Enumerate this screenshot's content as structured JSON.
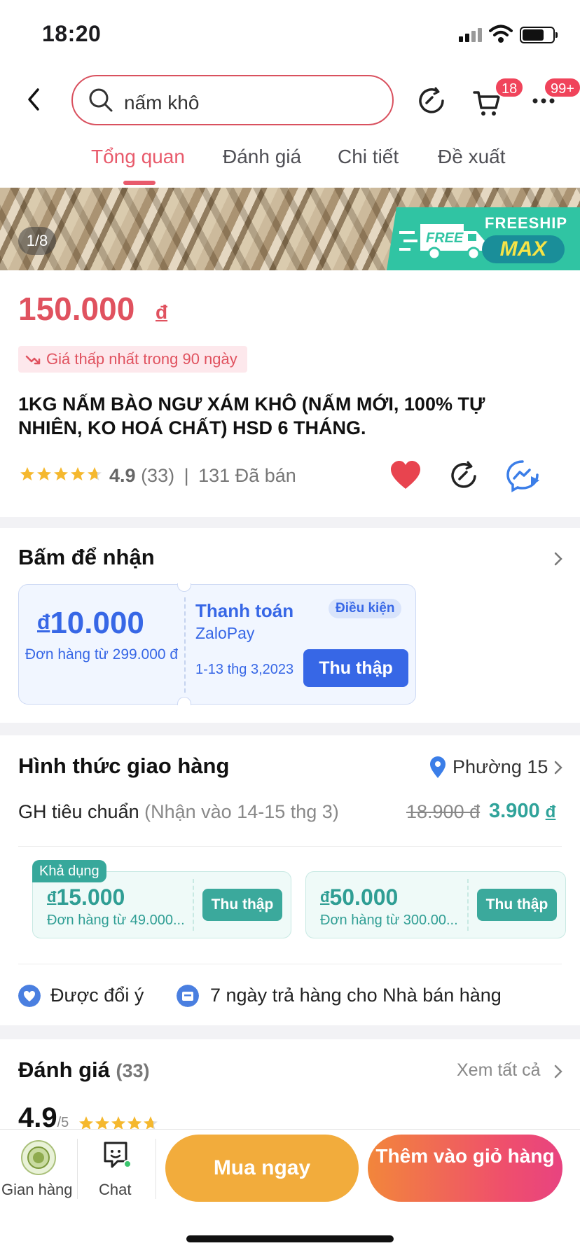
{
  "status_bar": {
    "time": "18:20"
  },
  "header": {
    "search_query": "nấm khô",
    "cart_badge": "18",
    "more_badge": "99+"
  },
  "tabs": [
    {
      "label": "Tổng quan",
      "active": true
    },
    {
      "label": "Đánh giá",
      "active": false
    },
    {
      "label": "Chi tiết",
      "active": false
    },
    {
      "label": "Đề xuất",
      "active": false
    }
  ],
  "banner": {
    "counter": "1/8",
    "badge_free": "FREE",
    "badge_title": "FREESHIP",
    "badge_max": "MAX"
  },
  "product": {
    "price": "150.000",
    "currency": "đ",
    "low_price_tag": "Giá thấp nhất trong 90 ngày",
    "title": "1KG NẤM BÀO NGƯ XÁM KHÔ (NẤM MỚI, 100% TỰ NHIÊN, KO HOÁ CHẤT) HSD 6 THÁNG.",
    "rating": "4.9",
    "rating_count": "(33)",
    "separator": "|",
    "sold": "131 Đã bán",
    "star_fill": 0.98
  },
  "voucher_section": {
    "title": "Bấm để nhận",
    "voucher": {
      "currency": "đ",
      "amount": "10.000",
      "min_order": "Đơn hàng từ 299.000 đ",
      "title": "Thanh toán",
      "subtitle": "ZaloPay",
      "condition": "Điều kiện",
      "date": "1-13 thg 3,2023",
      "button": "Thu thập"
    }
  },
  "shipping": {
    "title": "Hình thức giao hàng",
    "location": "Phường 15",
    "method": "GH tiêu chuẩn",
    "eta": "(Nhận vào 14-15 thg 3)",
    "old_price": "18.900 đ",
    "new_price": "3.900",
    "currency": "đ",
    "available_tag": "Khả dụng",
    "coupons": [
      {
        "currency": "đ",
        "amount": "15.000",
        "min_order": "Đơn hàng từ 49.000...",
        "button": "Thu thập"
      },
      {
        "currency": "đ",
        "amount": "50.000",
        "min_order": "Đơn hàng từ 300.00...",
        "button": "Thu thập"
      }
    ],
    "policies": [
      {
        "label": "Được đổi ý",
        "icon": "heart-shield-icon"
      },
      {
        "label": "7 ngày trả hàng cho Nhà bán hàng",
        "icon": "return-box-icon"
      }
    ]
  },
  "reviews": {
    "title": "Đánh giá",
    "count": "(33)",
    "see_all": "Xem tất cả",
    "score": "4.9",
    "out_of": "/5"
  },
  "bottom_bar": {
    "shop_label": "Gian hàng",
    "chat_label": "Chat",
    "buy_now": "Mua ngay",
    "add_to_cart": "Thêm vào giỏ hàng"
  },
  "colors": {
    "price": "#e0525f",
    "voucher_blue": "#3767e6",
    "shipping_teal": "#30a39a",
    "buy_now": "#f2ac3c",
    "add_cart_gradient_start": "#f2863b",
    "add_cart_gradient_end": "#e84380"
  }
}
